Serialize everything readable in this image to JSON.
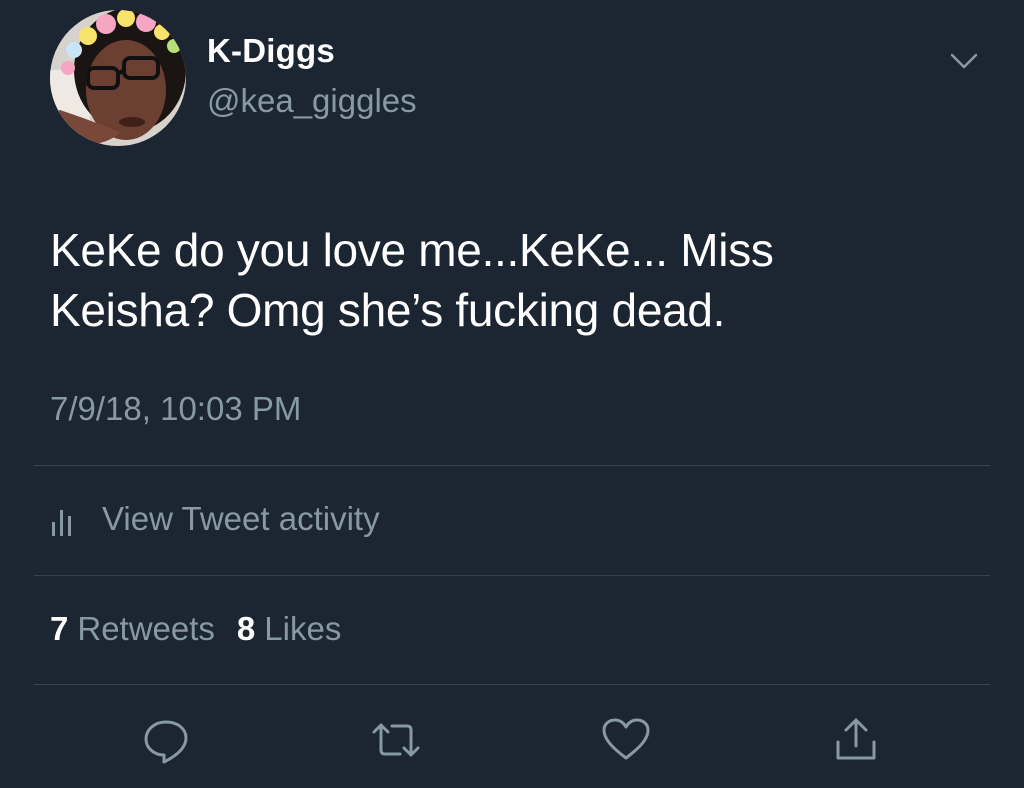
{
  "user": {
    "display_name": "K-Diggs",
    "handle": "@kea_giggles"
  },
  "tweet": {
    "text_line1": "KeKe do you love me...KeKe... Miss",
    "text_line2": "Keisha? Omg she’s fucking dead.",
    "timestamp": "7/9/18, 10:03 PM"
  },
  "activity": {
    "label": "View Tweet activity"
  },
  "stats": {
    "retweets_count": "7",
    "retweets_label": "Retweets",
    "likes_count": "8",
    "likes_label": "Likes"
  },
  "icons": {
    "caret": "chevron-down-icon",
    "activity": "bar-chart-icon",
    "reply": "reply-icon",
    "retweet": "retweet-icon",
    "like": "heart-icon",
    "share": "share-icon"
  },
  "colors": {
    "background": "#1c2532",
    "primary_text": "#ffffff",
    "secondary_text": "#8899a6",
    "divider": "#38444d"
  }
}
